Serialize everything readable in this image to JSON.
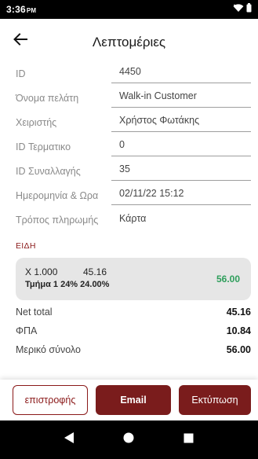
{
  "status_bar": {
    "time": "3:36",
    "period": "PM"
  },
  "header": {
    "title": "Λεπτομέριες"
  },
  "details": [
    {
      "label": "ID",
      "value": "4450"
    },
    {
      "label": "Όνομα πελάτη",
      "value": "Walk-in Customer"
    },
    {
      "label": "Χειριστής",
      "value": "Χρήστος Φωτάκης"
    },
    {
      "label": "ID Τερματικο",
      "value": "0"
    },
    {
      "label": "ID Συναλλαγής",
      "value": "35"
    },
    {
      "label": "Ημερομηνία & Ωρα",
      "value": "02/11/22 15:12"
    },
    {
      "label": "Τρόπος πληρωμής",
      "value": "Κάρτα"
    }
  ],
  "items_section": {
    "title": "ΕΙΔΗ"
  },
  "items": [
    {
      "qty": "X 1.000",
      "price": "45.16",
      "tax": "Τμήμα 1 24% 24.00%",
      "total": "56.00"
    }
  ],
  "summary": [
    {
      "label": "Net total",
      "value": "45.16"
    },
    {
      "label": "ΦΠΑ",
      "value": "10.84"
    },
    {
      "label": "Μερικό σύνολο",
      "value": "56.00"
    }
  ],
  "actions": {
    "return_label": "επιστροφής",
    "email_label": "Email",
    "print_label": "Εκτύπωση"
  },
  "colors": {
    "accent": "#7a1c1c",
    "total_green": "#2e9e5b",
    "card_bg": "#e6e6e6"
  },
  "icons": {
    "back": "arrow-left-icon",
    "wifi": "wifi-icon",
    "battery": "battery-icon",
    "nav_back": "triangle-back-icon",
    "nav_home": "circle-home-icon",
    "nav_recents": "square-recents-icon"
  }
}
